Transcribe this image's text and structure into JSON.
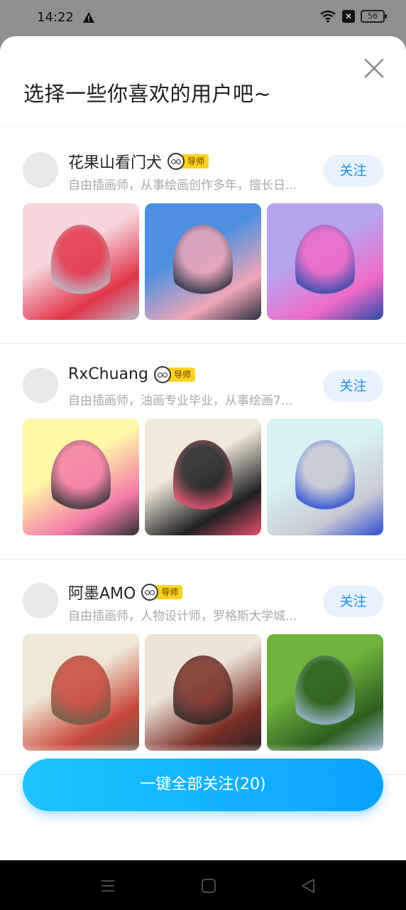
{
  "status_bar": {
    "time": "14:22",
    "battery": "56",
    "icons": [
      "warning-icon",
      "wifi-icon",
      "sim-off-icon",
      "battery-icon"
    ]
  },
  "sheet": {
    "title": "选择一些你喜欢的用户吧~",
    "close_icon": "close-icon"
  },
  "users": [
    {
      "name": "花果山看门犬",
      "badge": "导师",
      "bio": "自由插画师，从事绘画创作多年，擅长日...",
      "follow_label": "关注",
      "artworks": [
        {
          "colors": [
            "#f6d5db",
            "#e2344a",
            "#b8b8c4"
          ]
        },
        {
          "colors": [
            "#4d8fe0",
            "#f0a6b8",
            "#2b2f40"
          ]
        },
        {
          "colors": [
            "#b7a4f0",
            "#f06ac8",
            "#2a4aa8"
          ]
        }
      ]
    },
    {
      "name": "RxChuang",
      "badge": "导师",
      "bio": "自由插画师，油画专业毕业，从事绘画7...",
      "follow_label": "关注",
      "artworks": [
        {
          "colors": [
            "#fff7a8",
            "#f47aa8",
            "#2e2e35"
          ]
        },
        {
          "colors": [
            "#f0e8d8",
            "#1f1f22",
            "#e8506a"
          ]
        },
        {
          "colors": [
            "#d6f2f2",
            "#c8c8d4",
            "#2b4bd0"
          ]
        }
      ]
    },
    {
      "name": "阿墨AMO",
      "badge": "导师",
      "bio": "自由插画师，人物设计师，罗格斯大学城...",
      "follow_label": "关注",
      "artworks": [
        {
          "colors": [
            "#efe6d4",
            "#c9473b",
            "#6b5a48"
          ]
        },
        {
          "colors": [
            "#ece4d6",
            "#7a2e26",
            "#2b2523"
          ]
        },
        {
          "colors": [
            "#6fb23c",
            "#2d5e1e",
            "#9fb6d8"
          ]
        }
      ]
    }
  ],
  "follow_all_label": "一键全部关注(20)",
  "nav_bar": {
    "icons": [
      "menu-icon",
      "home-icon",
      "back-icon"
    ]
  }
}
